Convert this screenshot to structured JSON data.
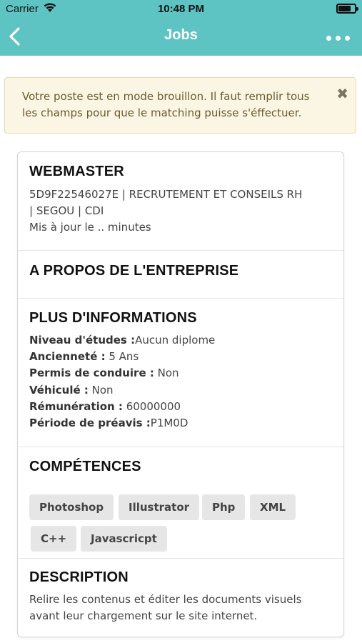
{
  "status": {
    "carrier": "Carrier",
    "time": "10:48 PM",
    "battery_level": 0.75
  },
  "nav": {
    "title": "Jobs",
    "back_icon": "chevron-left-icon",
    "more_icon": "more-horizontal-icon"
  },
  "alert": {
    "line1": "Votre poste est en mode brouillon. Il faut remplir tous",
    "line2": "les champs pour que le matching puisse s'éffectuer.",
    "close": "✖"
  },
  "job": {
    "title": "WEBMASTER",
    "meta_line1": "5D9F22546027E | RECRUTEMENT ET CONSEILS RH",
    "meta_line2": "| SEGOU | CDI",
    "updated": "Mis à jour le .. minutes"
  },
  "about": {
    "heading": "A PROPOS DE L'ENTREPRISE"
  },
  "info": {
    "heading": "PLUS D'INFORMATIONS",
    "rows": [
      {
        "label": "Niveau d'études :",
        "value": "Aucun diplome"
      },
      {
        "label": "Ancienneté :",
        "value": " 5 Ans"
      },
      {
        "label": "Permis de conduire :",
        "value": " Non"
      },
      {
        "label": "Véhiculé :",
        "value": " Non"
      },
      {
        "label": "Rémunération :",
        "value": " 60000000"
      },
      {
        "label": "Période de préavis :",
        "value": "P1M0D"
      }
    ]
  },
  "skills": {
    "heading": "COMPÉTENCES",
    "tags": [
      "Photoshop",
      "Illustrator",
      "Php",
      "XML",
      "C++",
      "Javascricpt"
    ]
  },
  "description": {
    "heading": "DESCRIPTION",
    "line1": "Relire les contenus et éditer les documents visuels",
    "line2": "avant leur chargement sur le site internet."
  },
  "colors": {
    "header": "#5ec4c3",
    "alert_bg": "#fbf6e3",
    "alert_text": "#6b5a2d",
    "tag_bg": "#e6e6e6"
  }
}
